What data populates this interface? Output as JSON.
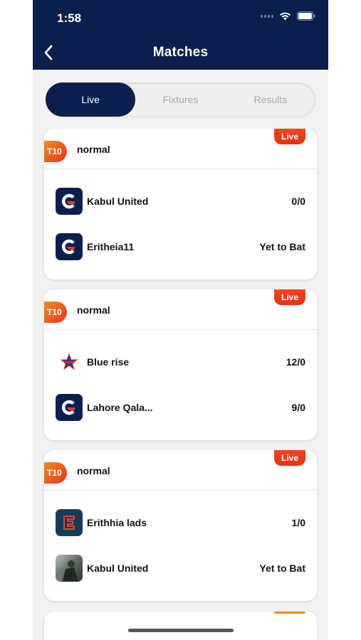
{
  "status_bar": {
    "time": "1:58"
  },
  "header": {
    "title": "Matches"
  },
  "tabs": [
    {
      "label": "Live",
      "active": true
    },
    {
      "label": "Fixtures",
      "active": false
    },
    {
      "label": "Results",
      "active": false
    }
  ],
  "matches": [
    {
      "format": "T10",
      "type": "normal",
      "status": "Live",
      "teams": [
        {
          "name": "Kabul United",
          "score": "0/0",
          "logo": "c-logo"
        },
        {
          "name": "Eritheia11",
          "score": "Yet to Bat",
          "logo": "c-logo"
        }
      ]
    },
    {
      "format": "T10",
      "type": "normal",
      "status": "Live",
      "teams": [
        {
          "name": "Blue rise",
          "score": "12/0",
          "logo": "star-logo"
        },
        {
          "name": "Lahore Qala...",
          "score": "9/0",
          "logo": "c-logo"
        }
      ]
    },
    {
      "format": "T10",
      "type": "normal",
      "status": "Live",
      "teams": [
        {
          "name": "Erithhia lads",
          "score": "1/0",
          "logo": "e-logo"
        },
        {
          "name": "Kabul United",
          "score": "Yet to Bat",
          "logo": "photo-logo"
        }
      ]
    }
  ],
  "colors": {
    "navy": "#0b1f4f",
    "live_red": "#e8321e",
    "t10_orange": "#f08b25"
  }
}
